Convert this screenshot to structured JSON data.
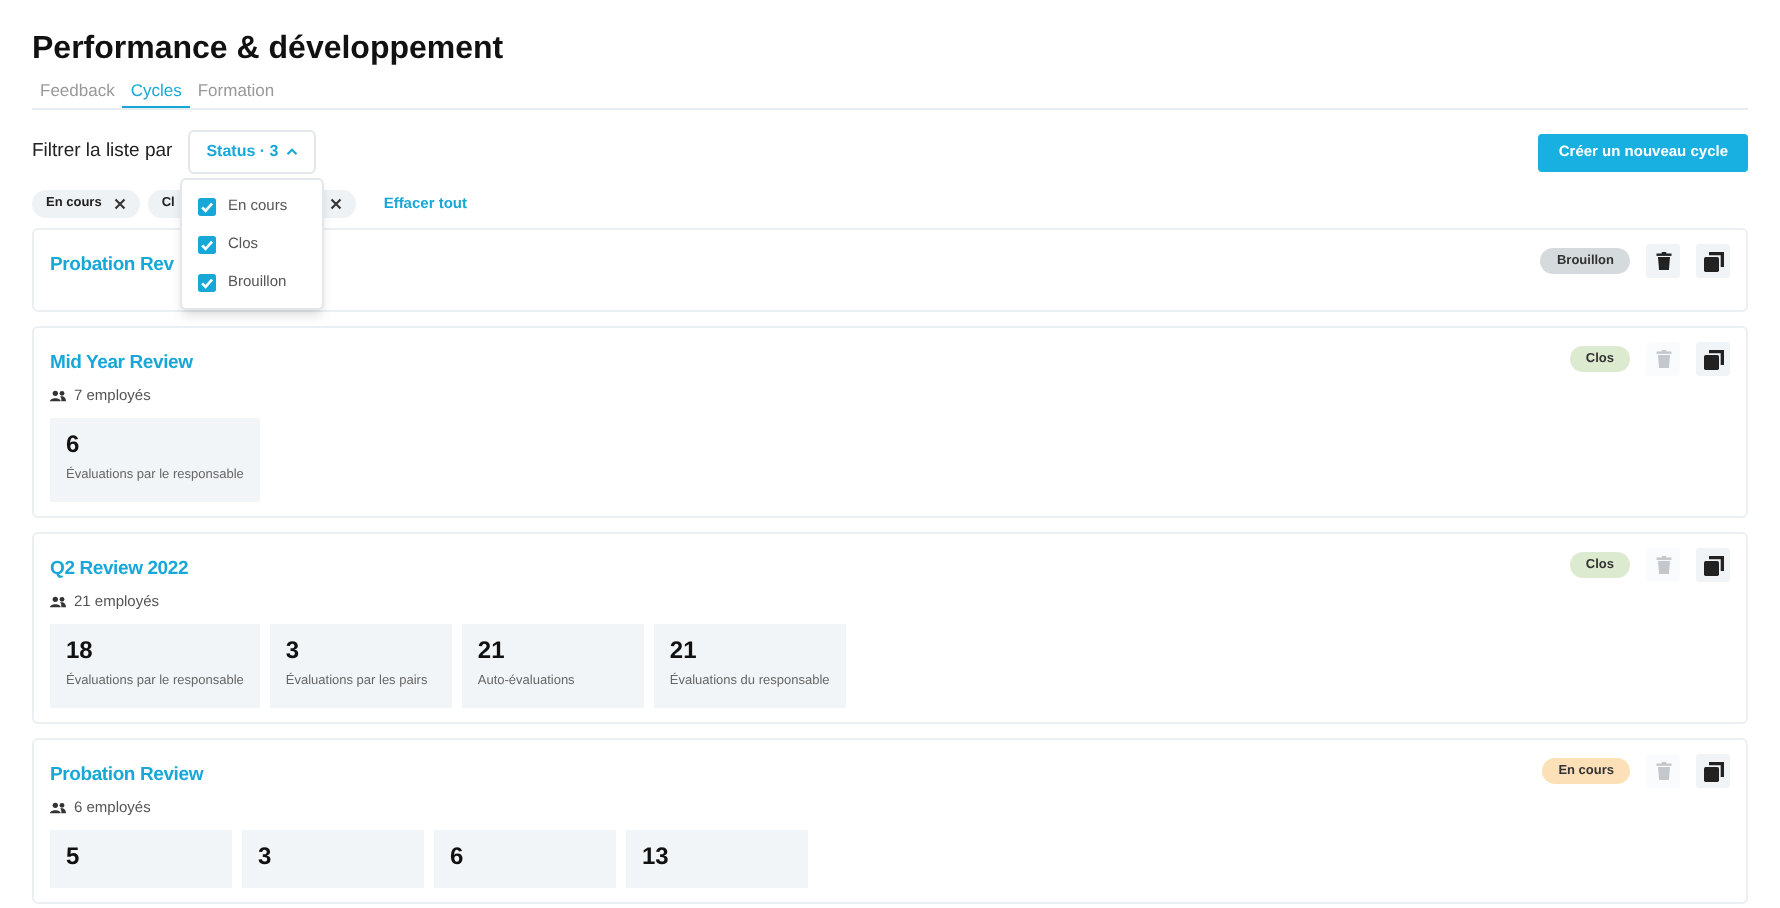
{
  "title": "Performance & développement",
  "tabs": [
    {
      "label": "Feedback",
      "selected": false
    },
    {
      "label": "Cycles",
      "selected": true
    },
    {
      "label": "Formation",
      "selected": false
    }
  ],
  "filter": {
    "label": "Filtrer la liste par",
    "button": "Status · 3",
    "expanded": true,
    "options": [
      {
        "label": "En cours",
        "checked": true
      },
      {
        "label": "Clos",
        "checked": true
      },
      {
        "label": "Brouillon",
        "checked": true
      }
    ]
  },
  "create_button": "Créer un nouveau cycle",
  "chips": [
    {
      "kind": "full",
      "label": "En cours"
    },
    {
      "kind": "cut",
      "label": "Cl"
    },
    {
      "kind": "covered"
    }
  ],
  "clear_all": "Effacer tout",
  "cycles": [
    {
      "title": "Probation Rev",
      "status": {
        "kind": "draft",
        "label": "Brouillon"
      },
      "delete_disabled": false
    },
    {
      "title": "Mid Year Review",
      "employees": "7 employés",
      "status": {
        "kind": "closed",
        "label": "Clos"
      },
      "delete_disabled": true,
      "stats": [
        {
          "value": "6",
          "label": "Évaluations par le responsable"
        }
      ]
    },
    {
      "title": "Q2 Review 2022",
      "employees": "21 employés",
      "status": {
        "kind": "closed",
        "label": "Clos"
      },
      "delete_disabled": true,
      "stats": [
        {
          "value": "18",
          "label": "Évaluations par le responsable"
        },
        {
          "value": "3",
          "label": "Évaluations par les pairs"
        },
        {
          "value": "21",
          "label": "Auto-évaluations"
        },
        {
          "value": "21",
          "label": "Évaluations du responsable"
        }
      ]
    },
    {
      "title": "Probation Review",
      "employees": "6 employés",
      "status": {
        "kind": "in_progress",
        "label": "En cours"
      },
      "delete_disabled": true,
      "stats": [
        {
          "value": "5"
        },
        {
          "value": "3"
        },
        {
          "value": "6"
        },
        {
          "value": "13"
        }
      ]
    }
  ]
}
